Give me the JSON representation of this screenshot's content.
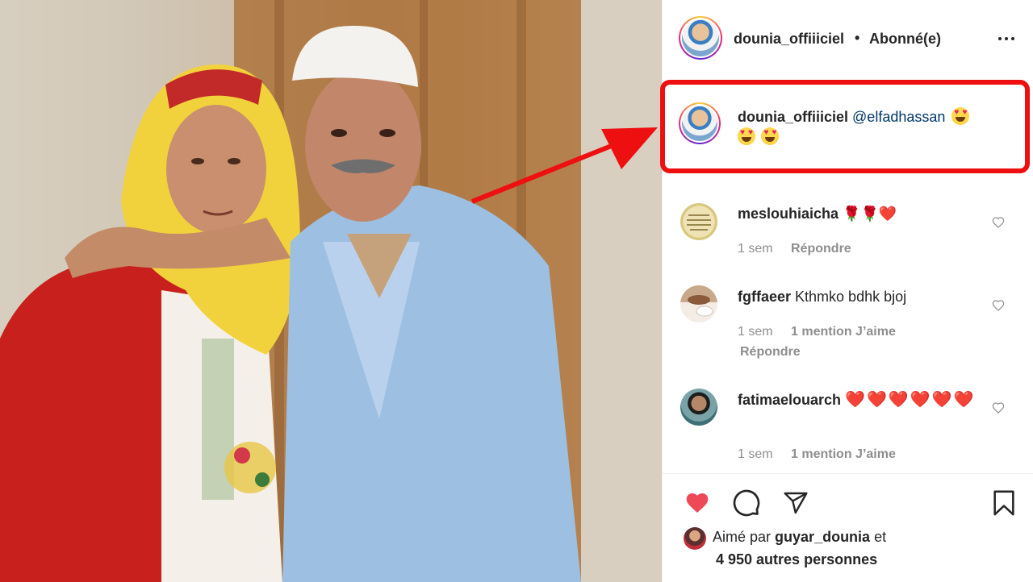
{
  "header": {
    "username": "dounia_offiiiciel",
    "separator": "•",
    "follow_status": "Abonné(e)"
  },
  "caption": {
    "username": "dounia_offiiiciel",
    "mention": "@elfadhassan",
    "emojis": [
      "😍",
      "😍",
      "😍"
    ]
  },
  "comments": [
    {
      "username": "meslouhiaicha",
      "text": "🌹🌹❤️",
      "time": "1 sem",
      "reply_label": "Répondre"
    },
    {
      "username": "fgffaeer",
      "text": "Kthmko bdhk bjoj",
      "time": "1 sem",
      "likes_label": "1 mention J’aime",
      "reply_label": "Répondre"
    },
    {
      "username": "fatimaelouarch",
      "text": "❤️❤️❤️❤️❤️❤️",
      "time": "1 sem",
      "likes_label": "1 mention J’aime"
    }
  ],
  "actions": {
    "icons": [
      "heart-filled-icon",
      "comment-icon",
      "share-icon",
      "bookmark-icon"
    ],
    "like_color": "#ed4956"
  },
  "likes": {
    "prefix": "Aimé par",
    "liker": "guyar_dounia",
    "suffix": "et",
    "others": "4 950 autres personnes"
  },
  "annotation": {
    "box_color": "#ee0f10",
    "arrow_color": "#ee0f10"
  }
}
